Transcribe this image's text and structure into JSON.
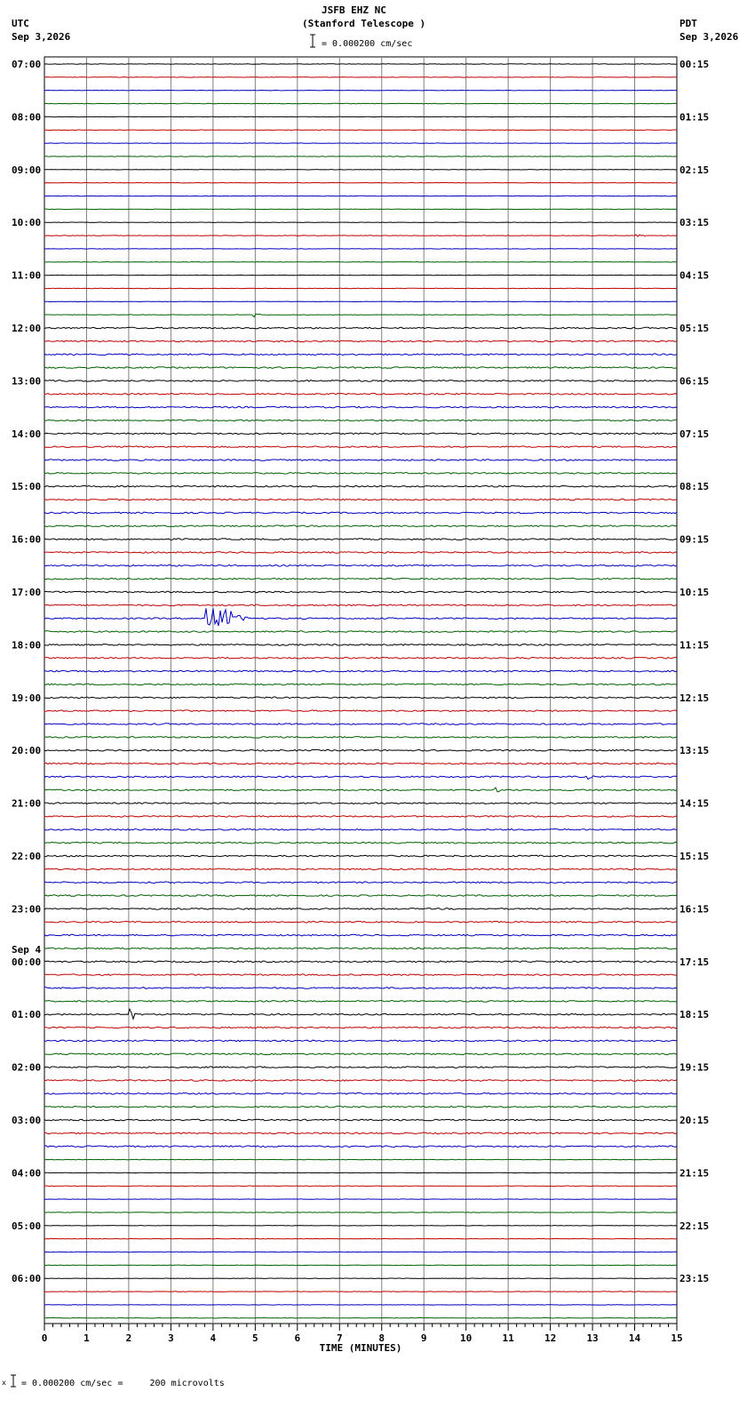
{
  "header": {
    "station": "JSFB EHZ NC",
    "site": "(Stanford Telescope )",
    "scale_text": "= 0.000200 cm/sec",
    "left_zone": "UTC",
    "left_date": "Sep 3,2026",
    "right_zone": "PDT",
    "right_date": "Sep 3,2026"
  },
  "footer": {
    "scale_note": "= 0.000200 cm/sec =     200 microvolts"
  },
  "chart_data": {
    "type": "line",
    "title": "JSFB EHZ NC (Stanford Telescope )",
    "xlabel": "TIME (MINUTES)",
    "xlim": [
      0,
      15
    ],
    "x_ticks": [
      "0",
      "1",
      "2",
      "3",
      "4",
      "5",
      "6",
      "7",
      "8",
      "9",
      "10",
      "11",
      "12",
      "13",
      "14",
      "15"
    ],
    "grid": true,
    "traces_per_hour": 4,
    "num_traces": 96,
    "trace_colors": [
      "#000000",
      "#c00000",
      "#0000c0",
      "#006000"
    ],
    "left_hour_labels": [
      "07:00",
      "08:00",
      "09:00",
      "10:00",
      "11:00",
      "12:00",
      "13:00",
      "14:00",
      "15:00",
      "16:00",
      "17:00",
      "18:00",
      "19:00",
      "20:00",
      "21:00",
      "22:00",
      "23:00",
      "00:00",
      "01:00",
      "02:00",
      "03:00",
      "04:00",
      "05:00",
      "06:00"
    ],
    "left_date_change": {
      "hour_index": 17,
      "label": "Sep 4"
    },
    "right_hour_labels": [
      "00:15",
      "01:15",
      "02:15",
      "03:15",
      "04:15",
      "05:15",
      "06:15",
      "07:15",
      "08:15",
      "09:15",
      "10:15",
      "11:15",
      "12:15",
      "13:15",
      "14:15",
      "15:15",
      "16:15",
      "17:15",
      "18:15",
      "19:15",
      "20:15",
      "21:15",
      "22:15",
      "23:15"
    ],
    "events": [
      {
        "trace": 42,
        "minute": 4.0,
        "duration": 0.9,
        "amplitude": 16
      },
      {
        "trace": 72,
        "minute": 2.05,
        "duration": 0.15,
        "amplitude": 9
      },
      {
        "trace": 13,
        "minute": 14.05,
        "duration": 0.2,
        "amplitude": 3
      },
      {
        "trace": 19,
        "minute": 5.0,
        "duration": 0.2,
        "amplitude": 3
      },
      {
        "trace": 55,
        "minute": 10.7,
        "duration": 0.2,
        "amplitude": 3
      },
      {
        "trace": 54,
        "minute": 12.9,
        "duration": 0.2,
        "amplitude": 3
      }
    ]
  }
}
